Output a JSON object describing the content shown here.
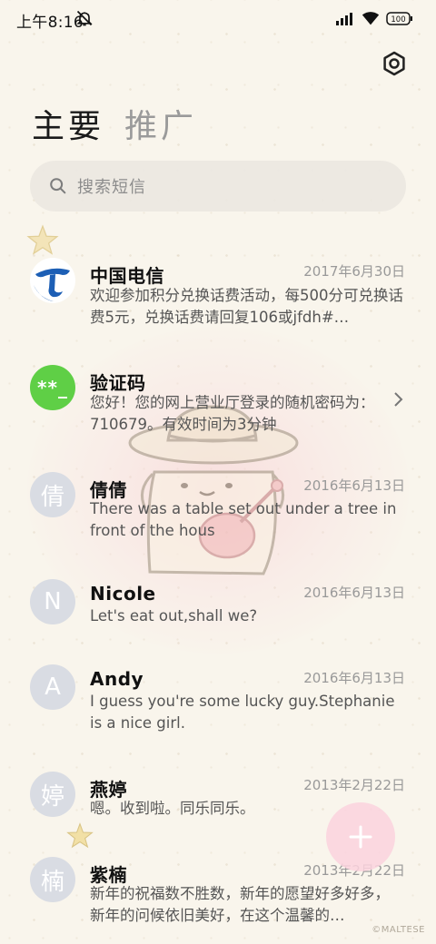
{
  "status_bar": {
    "time": "上午8:16",
    "battery": "100"
  },
  "tabs": [
    {
      "label": "主要"
    },
    {
      "label": "推广"
    }
  ],
  "search": {
    "placeholder": "搜索短信"
  },
  "conversations": [
    {
      "sender": "中国电信",
      "date": "2017年6月30日",
      "preview": "欢迎参加积分兑换话费活动，每500分可兑换话费5元，兑换话费请回复106或jfdh#…",
      "avatar": "telecom-logo"
    },
    {
      "sender": "验证码",
      "date": "",
      "preview": "您好！您的网上营业厅登录的随机密码为：710679。有效时间为3分钟",
      "avatar_text": "**_"
    },
    {
      "sender": "倩倩",
      "date": "2016年6月13日",
      "preview": "There was a table set out under a tree in front of the hous",
      "avatar_text": "倩"
    },
    {
      "sender": "Nicole",
      "date": "2016年6月13日",
      "preview": "Let's eat out,shall we?",
      "avatar_text": "N"
    },
    {
      "sender": "Andy",
      "date": "2016年6月13日",
      "preview": "I guess you're some lucky guy.Stephanie is a nice girl.",
      "avatar_text": "A"
    },
    {
      "sender": "燕婷",
      "date": "2013年2月22日",
      "preview": "嗯。收到啦。同乐同乐。",
      "avatar_text": "婷"
    },
    {
      "sender": "紫楠",
      "date": "2013年2月22日",
      "preview": "新年的祝福数不胜数，新年的愿望好多好多，新年的问候依旧美好，在这个温馨的…",
      "avatar_text": "楠"
    }
  ],
  "watermark": "©MALTESE",
  "colors": {
    "accent_green": "#5fcf46",
    "telecom_blue": "#1d5fb5",
    "fab_pink": "#fcd2de"
  }
}
